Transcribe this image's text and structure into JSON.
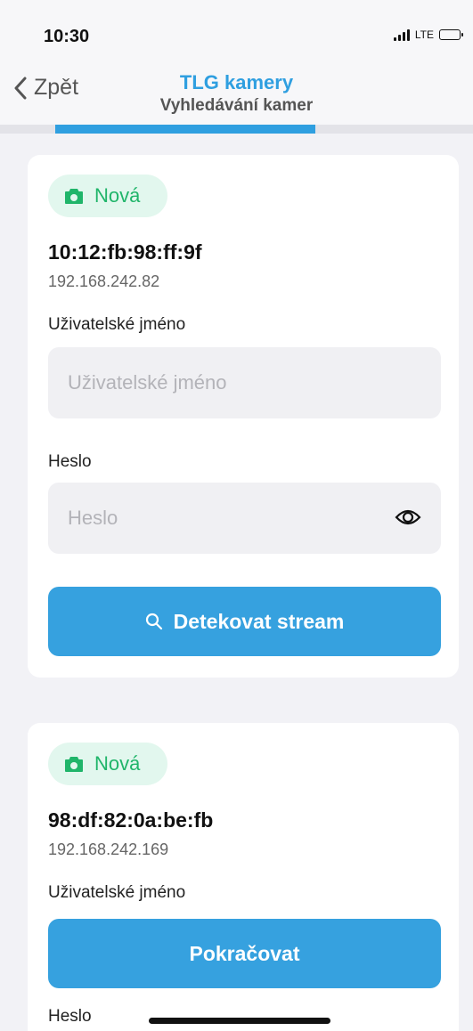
{
  "status_bar": {
    "time": "10:30",
    "network": "LTE"
  },
  "nav": {
    "back_label": "Zpět",
    "title": "TLG kamery",
    "subtitle": "Vyhledávání kamer",
    "progress": 0.55
  },
  "cameras": [
    {
      "badge": "Nová",
      "mac": "10:12:fb:98:ff:9f",
      "ip": "192.168.242.82",
      "username_label": "Uživatelské jméno",
      "username_placeholder": "Uživatelské jméno",
      "password_label": "Heslo",
      "password_placeholder": "Heslo",
      "button_label": "Detekovat stream"
    },
    {
      "badge": "Nová",
      "mac": "98:df:82:0a:be:fb",
      "ip": "192.168.242.169",
      "username_label": "Uživatelské jméno",
      "button_label": "Pokračovat",
      "password_label": "Heslo"
    }
  ],
  "colors": {
    "accent": "#36a1df",
    "badge_text": "#20b56a",
    "badge_bg": "#e2f7ee"
  }
}
